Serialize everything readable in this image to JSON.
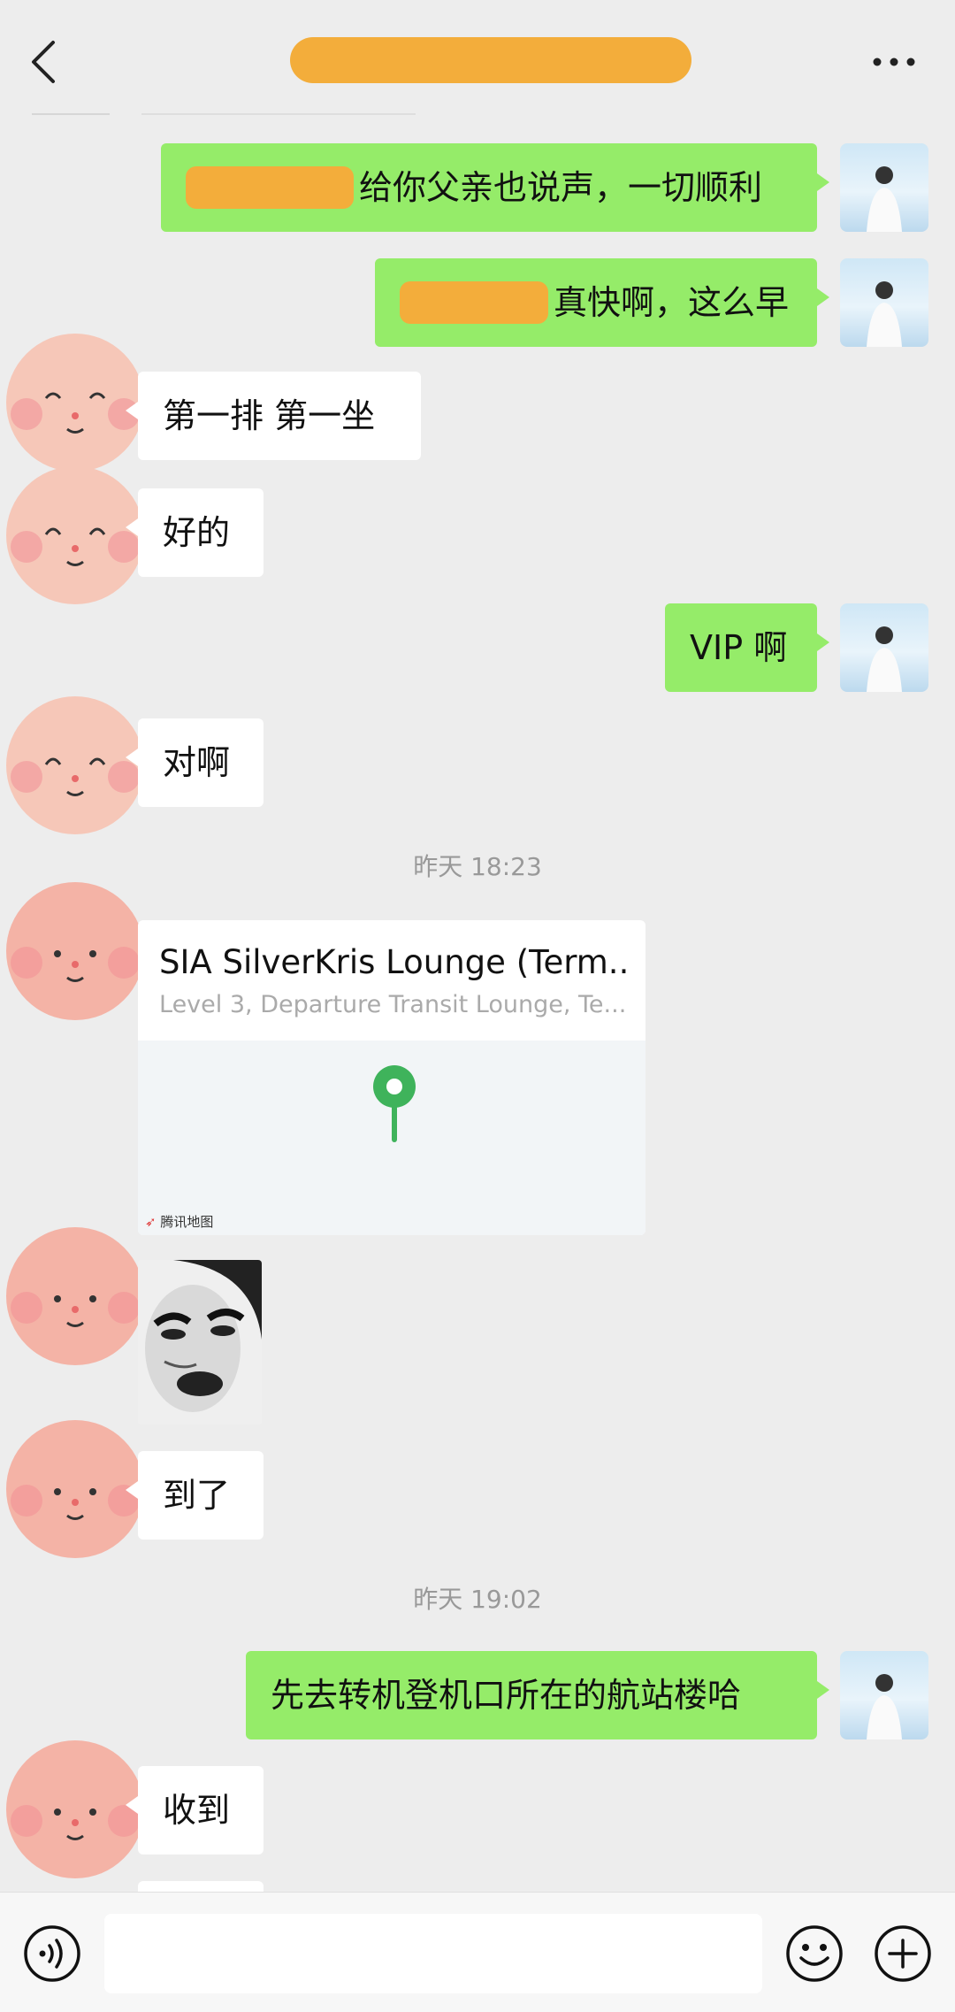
{
  "header": {
    "title": "",
    "back_icon": "chevron-left-icon",
    "more_icon": "ellipsis-icon"
  },
  "messages": [
    {
      "side": "self",
      "text": "给你父亲也说声，一切顺利"
    },
    {
      "side": "self",
      "text": "真快啊，这么早"
    },
    {
      "side": "other",
      "text": "第一排 第一坐"
    },
    {
      "side": "other",
      "text": "好的"
    },
    {
      "side": "self",
      "text": "VIP 啊"
    },
    {
      "side": "other",
      "text": "对啊"
    },
    {
      "side": "other",
      "text": "到了"
    },
    {
      "side": "self",
      "text": "先去转机登机口所在的航站楼哈"
    },
    {
      "side": "other",
      "text": "收到"
    }
  ],
  "timestamps": [
    "昨天 18:23",
    "昨天 19:02"
  ],
  "location_card": {
    "title": "SIA SilverKris Lounge (Term...",
    "address": "Level 3, Departure Transit Lounge, Te...",
    "map_brand": "腾讯地图",
    "pin_color": "#3fb35b"
  },
  "colors": {
    "background": "#ededed",
    "self_bubble": "#95ec69",
    "other_bubble": "#ffffff",
    "redaction": "#f3ad3b"
  },
  "bottom_bar": {
    "voice_icon": "voice-icon",
    "emoji_icon": "emoji-icon",
    "plus_icon": "plus-icon",
    "input_value": ""
  }
}
